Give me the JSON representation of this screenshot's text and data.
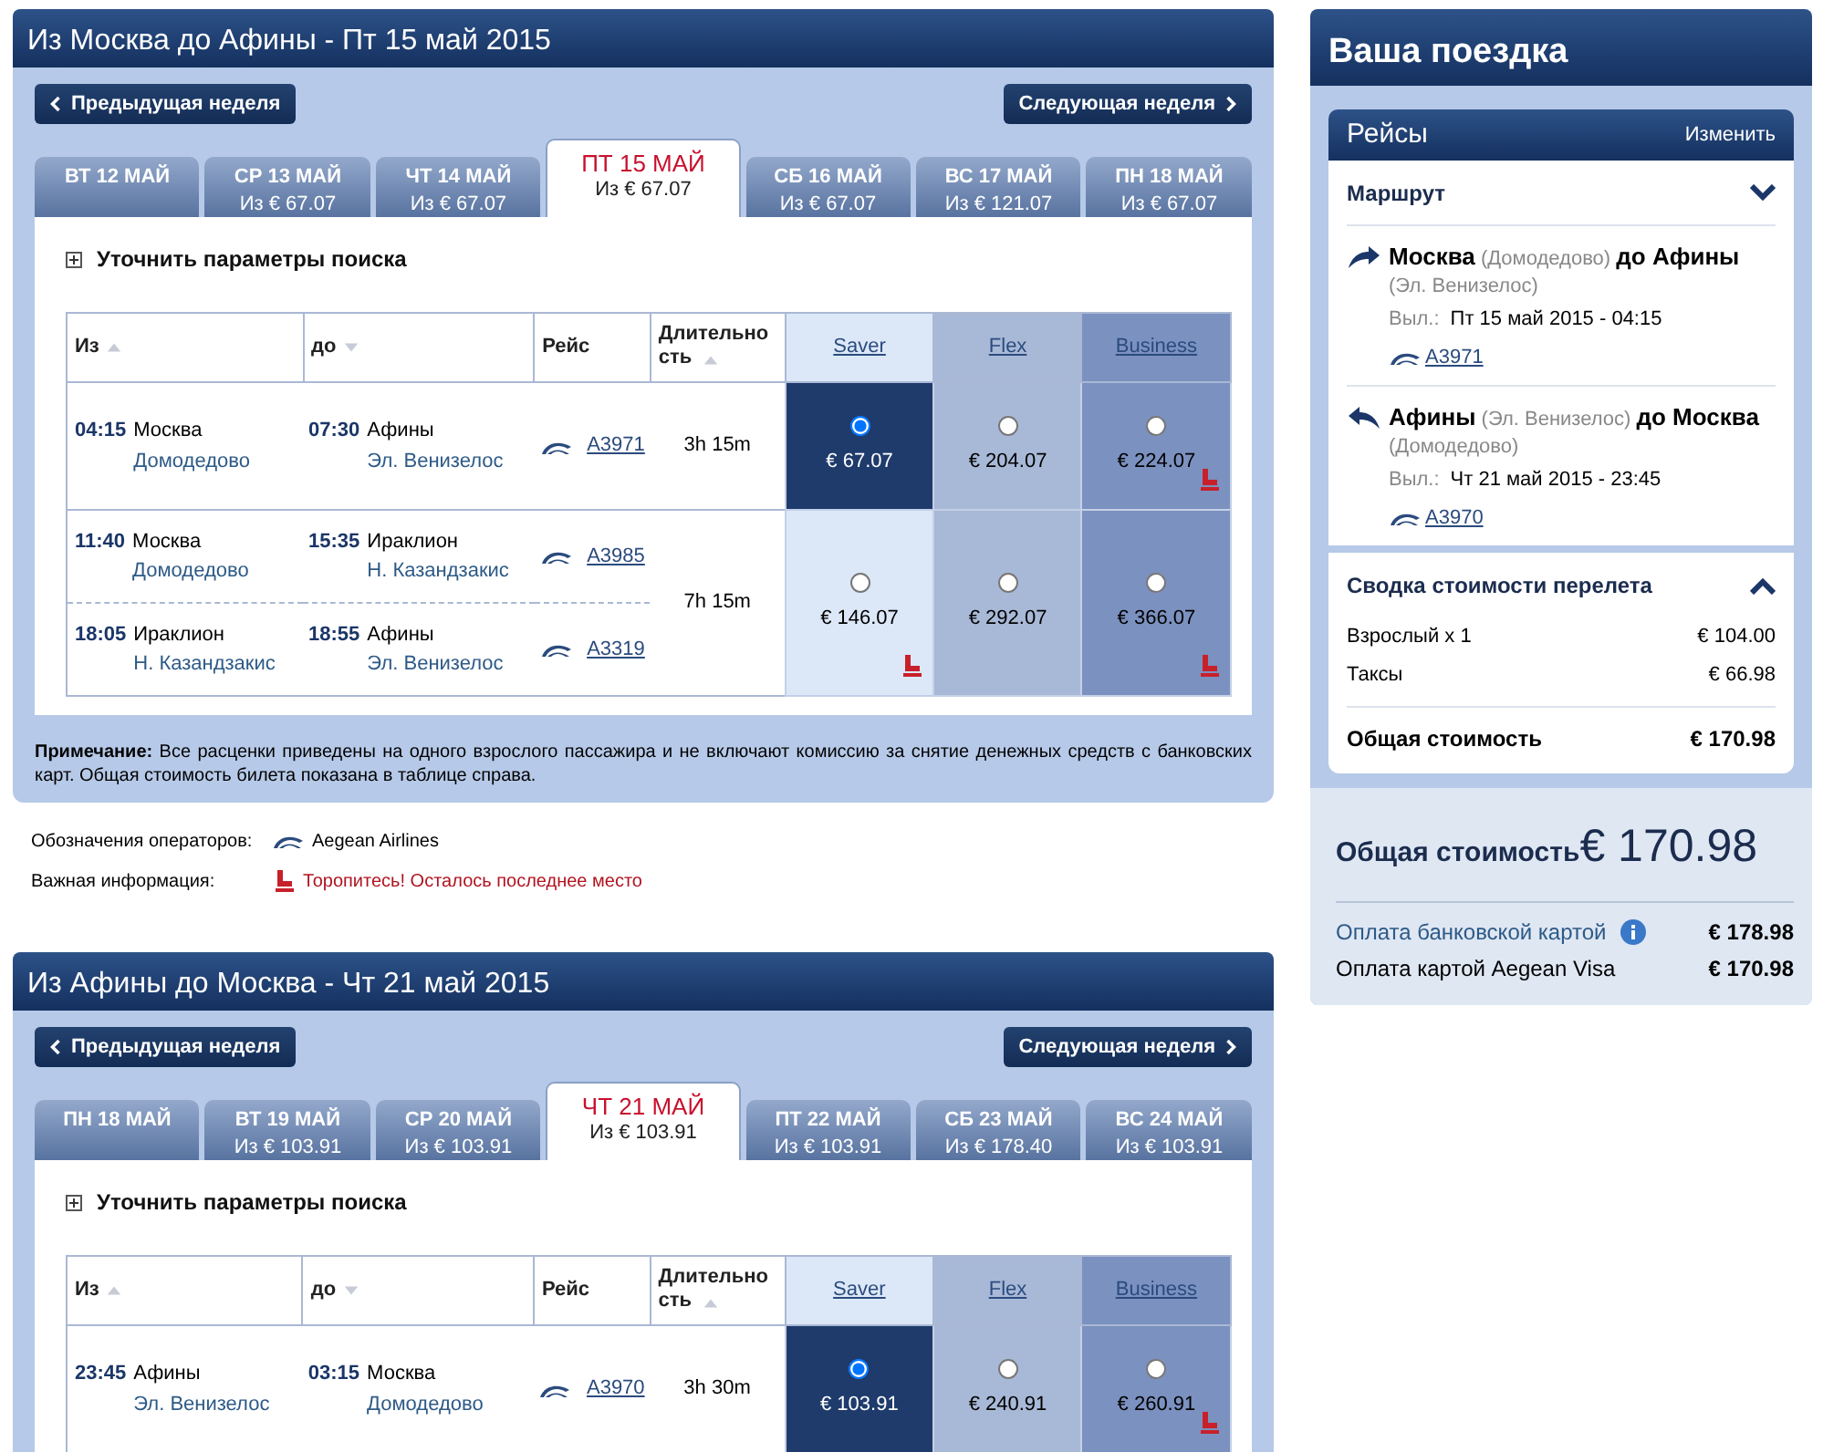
{
  "flight_sections": [
    {
      "title": "Из Москва до Афины - Пт 15 май 2015",
      "prev_button": "Предыдущая неделя",
      "next_button": "Следующая неделя",
      "day_tabs": [
        {
          "day": "ВТ 12 МАЙ",
          "selected": false
        },
        {
          "day": "СР 13 МАЙ",
          "price": "Из  € 67.07",
          "selected": false
        },
        {
          "day": "ЧТ 14 МАЙ",
          "price": "Из  € 67.07",
          "selected": false
        },
        {
          "day": "ПТ 15 МАЙ",
          "price": "Из  € 67.07",
          "selected": true
        },
        {
          "day": "СБ 16 МАЙ",
          "price": "Из  € 67.07",
          "selected": false
        },
        {
          "day": "ВС 17 МАЙ",
          "price": "Из  € 121.07",
          "selected": false
        },
        {
          "day": "ПН 18 МАЙ",
          "price": "Из  € 67.07",
          "selected": false
        }
      ],
      "refine_label": "Уточнить параметры поиска",
      "columns": [
        {
          "label": "Из",
          "sort_ascending": true
        },
        {
          "label": "до",
          "sort_ascending": false
        },
        {
          "label": "Рейс"
        },
        {
          "label": "Длительность",
          "sort_ascending": true
        }
      ],
      "fare_columns": [
        "Saver",
        "Flex",
        "Business"
      ],
      "rows": [
        {
          "segments": [
            {
              "dep_time": "04:15",
              "dep_city": "Москва",
              "dep_airport": "Домодедово",
              "arr_time": "07:30",
              "arr_city": "Афины",
              "arr_airport": "Эл. Венизелос",
              "flight": "A3971"
            }
          ],
          "duration": "3h 15m",
          "fares": [
            {
              "price": "€ 67.07",
              "selected": true,
              "last_seat": false
            },
            {
              "price": "€ 204.07",
              "selected": false,
              "last_seat": false
            },
            {
              "price": "€ 224.07",
              "selected": false,
              "last_seat": true
            }
          ]
        },
        {
          "segments": [
            {
              "dep_time": "11:40",
              "dep_city": "Москва",
              "dep_airport": "Домодедово",
              "arr_time": "15:35",
              "arr_city": "Ираклион",
              "arr_airport": "Н. Казандзакис",
              "flight": "A3985"
            },
            {
              "dep_time": "18:05",
              "dep_city": "Ираклион",
              "dep_airport": "Н. Казандзакис",
              "arr_time": "18:55",
              "arr_city": "Афины",
              "arr_airport": "Эл. Венизелос",
              "flight": "A3319"
            }
          ],
          "duration": "7h 15m",
          "fares": [
            {
              "price": "€ 146.07",
              "selected": false,
              "last_seat": true
            },
            {
              "price": "€ 292.07",
              "selected": false,
              "last_seat": false
            },
            {
              "price": "€ 366.07",
              "selected": false,
              "last_seat": true
            }
          ]
        }
      ],
      "note": {
        "label": "Примечание:",
        "text": "Все расценки приведены на одного взрослого пассажира и не включают комиссию за снятие денежных средств с банковских карт. Общая стоимость билета показана в таблице справа."
      },
      "legend": [
        {
          "kind": "operator",
          "label": "Обозначения операторов:",
          "text": "Aegean Airlines"
        },
        {
          "kind": "warning",
          "label": "Важная информация:",
          "text": "Торопитесь! Осталось последнее место"
        }
      ]
    },
    {
      "title": "Из Афины до Москва - Чт 21 май 2015",
      "prev_button": "Предыдущая неделя",
      "next_button": "Следующая неделя",
      "day_tabs": [
        {
          "day": "ПН 18 МАЙ",
          "selected": false
        },
        {
          "day": "ВТ 19 МАЙ",
          "price": "Из  € 103.91",
          "selected": false
        },
        {
          "day": "СР 20 МАЙ",
          "price": "Из  € 103.91",
          "selected": false
        },
        {
          "day": "ЧТ 21 МАЙ",
          "price": "Из  € 103.91",
          "selected": true
        },
        {
          "day": "ПТ 22 МАЙ",
          "price": "Из  € 103.91",
          "selected": false
        },
        {
          "day": "СБ 23 МАЙ",
          "price": "Из  € 178.40",
          "selected": false
        },
        {
          "day": "ВС 24 МАЙ",
          "price": "Из  € 103.91",
          "selected": false
        }
      ],
      "refine_label": "Уточнить параметры поиска",
      "columns": [
        {
          "label": "Из",
          "sort_ascending": true
        },
        {
          "label": "до",
          "sort_ascending": false
        },
        {
          "label": "Рейс"
        },
        {
          "label": "Длительность",
          "sort_ascending": true
        }
      ],
      "fare_columns": [
        "Saver",
        "Flex",
        "Business"
      ],
      "rows": [
        {
          "segments": [
            {
              "dep_time": "23:45",
              "dep_city": "Афины",
              "dep_airport": "Эл. Венизелос",
              "arr_time": "03:15",
              "arr_city": "Москва",
              "arr_airport": "Домодедово",
              "flight": "A3970"
            }
          ],
          "duration": "3h 30m",
          "fares": [
            {
              "price": "€ 103.91",
              "selected": true,
              "last_seat": false
            },
            {
              "price": "€ 240.91",
              "selected": false,
              "last_seat": false
            },
            {
              "price": "€ 260.91",
              "selected": false,
              "last_seat": true
            }
          ]
        }
      ]
    }
  ],
  "trip": {
    "title": "Ваша поездка",
    "flights_header": "Рейсы",
    "change_link": "Изменить",
    "route_label": "Маршрут",
    "legs": [
      {
        "kind": "outbound",
        "route": "**Москва** (Домодедово) **до Афины** (Эл. Венизелос)",
        "dep_label": "Выл.:",
        "dep_value": "Пт 15 май 2015 - 04:15",
        "flight": "A3971"
      },
      {
        "kind": "return",
        "route": "**Афины** (Эл. Венизелос) **до Москва** (Домодедово)",
        "dep_label": "Выл.:",
        "dep_value": "Чт 21 май 2015 - 23:45",
        "flight": "A3970"
      }
    ],
    "summary_title": "Сводка стоимости перелета",
    "items": [
      {
        "label": "Взрослый x 1",
        "value": "€ 104.00"
      },
      {
        "label": "Таксы",
        "value": "€ 66.98"
      }
    ],
    "total_label": "Общая стоимость",
    "total_value": "€ 170.98",
    "grand_label": "Общая стоимость",
    "grand_value": "€ 170.98",
    "payments": [
      {
        "label": "Оплата банковской картой",
        "value": "€ 178.98",
        "info": true
      },
      {
        "label": "Оплата картой Aegean Visa",
        "value": "€ 170.98",
        "info": false
      }
    ]
  }
}
